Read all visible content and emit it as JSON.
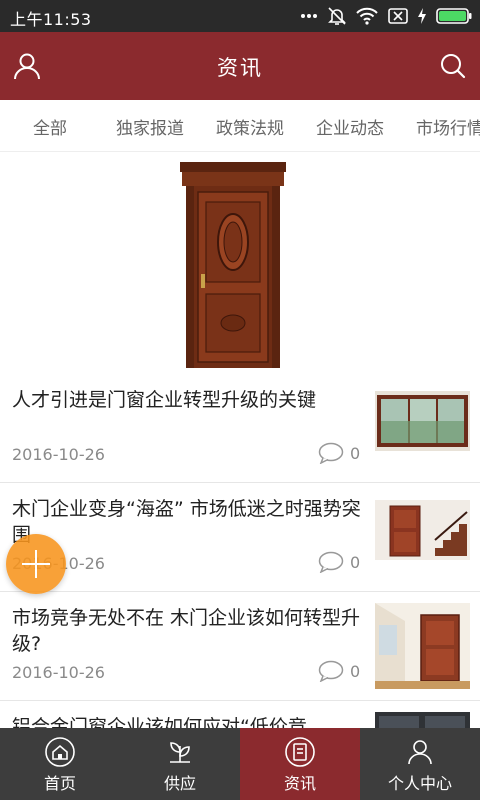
{
  "status_bar": {
    "time": "上午11:53",
    "icons": [
      "more-dots-icon",
      "notifications-off-icon",
      "wifi-icon",
      "sim-card-icon",
      "charging-bolt-icon",
      "battery-icon"
    ]
  },
  "header": {
    "title": "资讯",
    "background": "#8b2a2e",
    "left_icon": "user-icon",
    "right_icon": "search-icon"
  },
  "tabs": [
    "全部",
    "独家报道",
    "政策法规",
    "企业动态",
    "市场行情"
  ],
  "articles": [
    {
      "title": "人才引进是门窗企业转型升级的关键",
      "date": "2016-10-26",
      "comments": "0",
      "thumb": "window-frame-image"
    },
    {
      "title": "木门企业变身“海盗” 市场低迷之时强势突围",
      "date": "2016-10-26",
      "comments": "0",
      "thumb": "door-staircase-image"
    },
    {
      "title": "市场竞争无处不在 木门企业该如何转型升级?",
      "date": "2016-10-26",
      "comments": "0",
      "thumb": "door-room-image"
    },
    {
      "title": "铝合金门窗企业该如何应对“低价竞",
      "thumb": "aluminum-window-image"
    }
  ],
  "bottom_nav": [
    {
      "label": "首页",
      "icon": "home-icon",
      "active": false
    },
    {
      "label": "供应",
      "icon": "plant-icon",
      "active": false
    },
    {
      "label": "资讯",
      "icon": "news-icon",
      "active": true
    },
    {
      "label": "个人中心",
      "icon": "profile-icon",
      "active": false
    }
  ],
  "fab": {
    "icon": "plus-icon",
    "color": "#f7941d"
  }
}
